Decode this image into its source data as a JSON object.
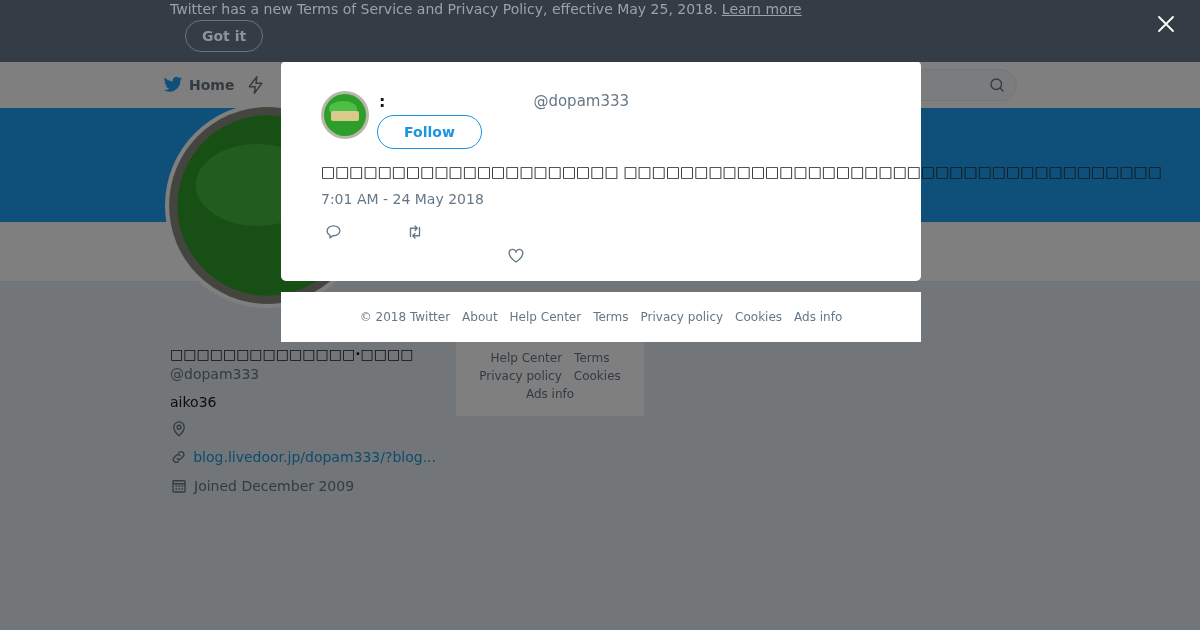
{
  "banner": {
    "text": "Twitter has a new Terms of Service and Privacy Policy, effective May 25, 2018.",
    "link": "Learn more",
    "button": "Got it"
  },
  "nav": {
    "home": "Home"
  },
  "profile": {
    "name": "□□□□□□□□□□□□□□·□□□□",
    "handle": "@dopam333",
    "bio": "aiko36",
    "url": "blog.livedoor.jp/dopam333/?blog...",
    "joined": "Joined December 2009"
  },
  "side_footer": {
    "links": [
      "Help Center",
      "Terms",
      "Privacy policy",
      "Cookies",
      "Ads info"
    ]
  },
  "modal": {
    "name": ":",
    "handle": "@dopam333",
    "follow": "Follow",
    "text": "□□□□□□□□□□□□□□□□□□□□□ □□□□□□□□□□□□□□□□□□□□□□□□□□□□□□□□□□□□□□",
    "time": "7:01 AM - 24 May 2018"
  },
  "footer": {
    "links": [
      "© 2018 Twitter",
      "About",
      "Help Center",
      "Terms",
      "Privacy policy",
      "Cookies",
      "Ads info"
    ]
  }
}
